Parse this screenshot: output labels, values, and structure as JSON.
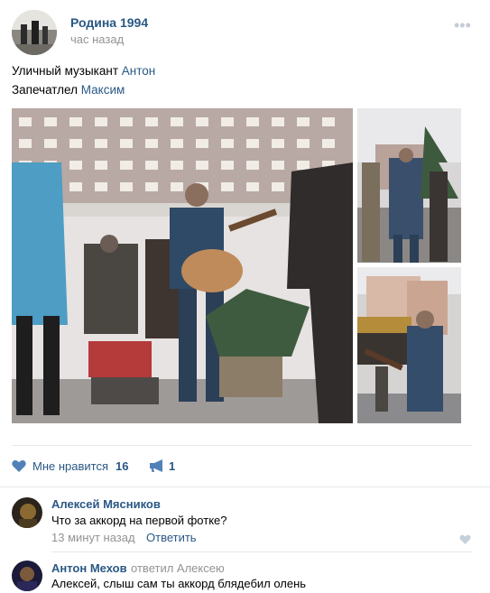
{
  "post": {
    "author": "Родина 1994",
    "time": "час назад",
    "more": "•••",
    "line1_text": "Уличный музыкант ",
    "line1_link": "Антон",
    "line2_text": "Запечатлел ",
    "line2_link": "Максим"
  },
  "actions": {
    "like_label": "Мне нравится",
    "like_count": "16",
    "share_count": "1"
  },
  "comments": [
    {
      "author": "Алексей Мясников",
      "text": "Что за аккорд на первой фотке?",
      "time": "13 минут назад",
      "reply_label": "Ответить"
    },
    {
      "author": "Антон Мехов",
      "replied_to": "ответил Алексею",
      "text": "Алексей, слыш сам ты аккорд блядебил олень"
    }
  ],
  "colors": {
    "link": "#2a5885",
    "muted": "#939393",
    "divider": "#e7e8ec",
    "icon": "#5181b8"
  }
}
